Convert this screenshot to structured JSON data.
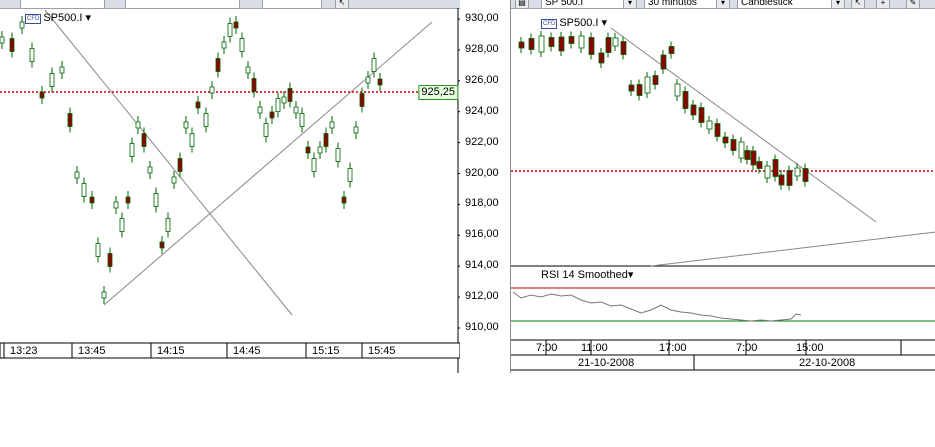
{
  "left_chart": {
    "symbol": "SP500.I",
    "symbol_dropdown": "▾",
    "cfd_badge": "CFD",
    "current_price": "925,25",
    "y_labels": [
      "930,00",
      "928,00",
      "926,00",
      "924,00",
      "922,00",
      "920,00",
      "918,00",
      "916,00",
      "914,00",
      "912,00",
      "910,00"
    ],
    "x_labels": [
      "13:23",
      "13:45",
      "14:15",
      "14:45",
      "15:15",
      "15:45"
    ]
  },
  "right_chart": {
    "symbol_field": "SP 500.I",
    "interval_field": "30 minutos",
    "chart_type_field": "Candlestick",
    "symbol": "SP500.I",
    "symbol_dropdown": "▾",
    "cfd_badge": "CFD",
    "y_labels": [
      "930,00",
      "928,00",
      "926,00",
      "924,00",
      "922,00",
      "920,00",
      "918,00",
      "916,00",
      "914,00",
      "912,00",
      "910,00"
    ],
    "x_labels": [
      "7:00",
      "11:00",
      "17:00",
      "7:00",
      "15:00"
    ],
    "date_labels": [
      "21-10-2008",
      "22-10-2008"
    ],
    "rsi_label": "RSI 14 Smoothed",
    "rsi_dropdown": "▾"
  },
  "colors": {
    "bull_candle": "#ffffff",
    "bear_candle": "#8b0000",
    "wick": "#006400",
    "price_line": "#cc0000",
    "rsi_upper": "#cc0000",
    "rsi_lower": "#008000",
    "trendline": "#888888"
  }
}
